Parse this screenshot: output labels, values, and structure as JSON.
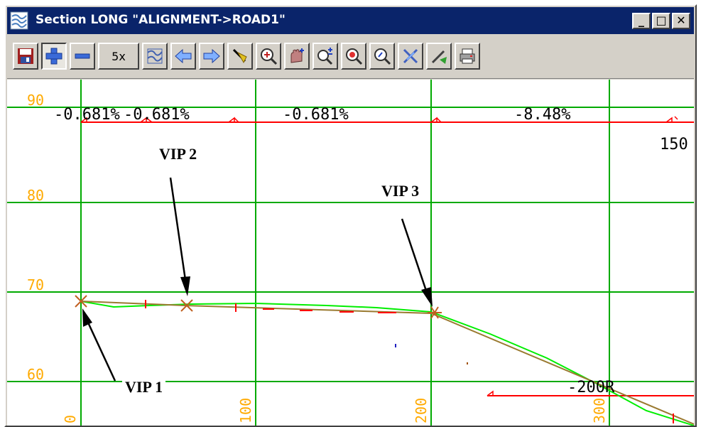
{
  "window": {
    "title": "Section LONG \"ALIGNMENT->ROAD1\""
  },
  "titlebar_buttons": [
    {
      "name": "minimize-button",
      "glyph": "_"
    },
    {
      "name": "maximize-button",
      "glyph": "□"
    },
    {
      "name": "close-button",
      "glyph": "✕"
    }
  ],
  "toolbar": {
    "zoom_factor_label": "5x",
    "buttons": [
      "save-icon",
      "plus-icon",
      "minus-icon",
      "zoom-factor",
      "profile-icon",
      "arrow-left-icon",
      "arrow-right-icon",
      "pick-icon",
      "zoom-in-icon",
      "pan-icon",
      "zoom-plus-minus-icon",
      "zoom-target-icon",
      "zoom-out-icon",
      "cross-icon",
      "draw-icon",
      "print-icon"
    ]
  },
  "section": {
    "y_tick_labels": [
      "90",
      "80",
      "70",
      "60"
    ],
    "x_tick_labels": [
      "0",
      "100",
      "200",
      "300"
    ],
    "grade_labels": [
      "-0.681%",
      "-0.681%",
      "-0.681%",
      "-8.48%"
    ],
    "chainage_label": "150",
    "vertical_curve_label": "-200R",
    "annotations": [
      "VIP 1",
      "VIP 2",
      "VIP 3"
    ]
  },
  "colors": {
    "grid": "#00aa00",
    "grade_line": "#ff0000",
    "design": "#9a7a30",
    "surface": "#00ff00",
    "axis_text": "#ffaa00",
    "title_bar": "#0a246a"
  }
}
